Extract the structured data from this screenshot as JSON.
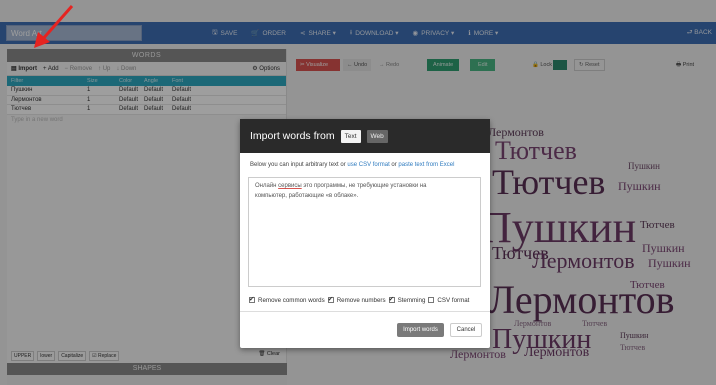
{
  "app": {
    "title": "Word Art",
    "back_label": "BACK"
  },
  "nav": {
    "save": "SAVE",
    "order": "ORDER",
    "share": "SHARE ▾",
    "download": "DOWNLOAD ▾",
    "privacy": "PRIVACY ▾",
    "more": "MORE ▾"
  },
  "words_panel": {
    "title": "WORDS",
    "toolbar": {
      "import": "Import",
      "add": "+ Add",
      "remove": "− Remove",
      "up": "↑ Up",
      "down": "↓ Down",
      "options": "⚙ Options"
    },
    "columns": [
      "Filter",
      "Size",
      "Color",
      "Angle",
      "Font"
    ],
    "rows": [
      {
        "word": "Пушкин",
        "size": "1",
        "color": "Default",
        "angle": "Default",
        "font": "Default"
      },
      {
        "word": "Лермонтов",
        "size": "1",
        "color": "Default",
        "angle": "Default",
        "font": "Default"
      },
      {
        "word": "Тютчев",
        "size": "1",
        "color": "Default",
        "angle": "Default",
        "font": "Default"
      }
    ],
    "new_word_placeholder": "Type in a new word",
    "case_buttons": [
      "UPPER",
      "lower",
      "Capitalize",
      "☑ Replace"
    ],
    "clear": "🗑 Clear",
    "shapes_title": "SHAPES"
  },
  "canvas_toolbar": {
    "visualize": "✂ Visualize",
    "undo": "← Undo",
    "redo": "→ Redo",
    "animate": "Animate",
    "edit": "Edit",
    "lock": "🔒 Lock",
    "reset": "↻ Reset",
    "print": "🖶 Print",
    "accent_color": "#2e8a6e"
  },
  "modal": {
    "title": "Import words from",
    "tab_text": "Text",
    "tab_web": "Web",
    "desc_prefix": "Below you can input arbitrary text or ",
    "desc_link1": "use CSV format",
    "desc_mid": " or ",
    "desc_link2": "paste text from Excel",
    "text_line1_a": "Онлайн ",
    "text_line1_u": "сервисы",
    "text_line1_b": " это программы, не требующие установки на",
    "text_line2": "компьютер, работающие «в облаке».",
    "opt_remove_common": "Remove common words",
    "opt_remove_numbers": "Remove numbers",
    "opt_stemming": "Stemming",
    "opt_csv": "CSV format",
    "import_button": "Import words",
    "cancel_button": "Cancel"
  },
  "cloud": {
    "words": [
      "Лермонтов",
      "Тютчев",
      "Пушкин",
      "Тютчев",
      "Пушкин",
      "Пушкин",
      "Тютчев",
      "Пушкин",
      "Тютчев",
      "Лермонтов",
      "Пушкин",
      "Лермонтов",
      "Тютчев",
      "Лермонтов",
      "Тютчев",
      "Пушкин",
      "Пушкин",
      "Лермонтов",
      "Лермонтов",
      "Тютчев"
    ]
  }
}
